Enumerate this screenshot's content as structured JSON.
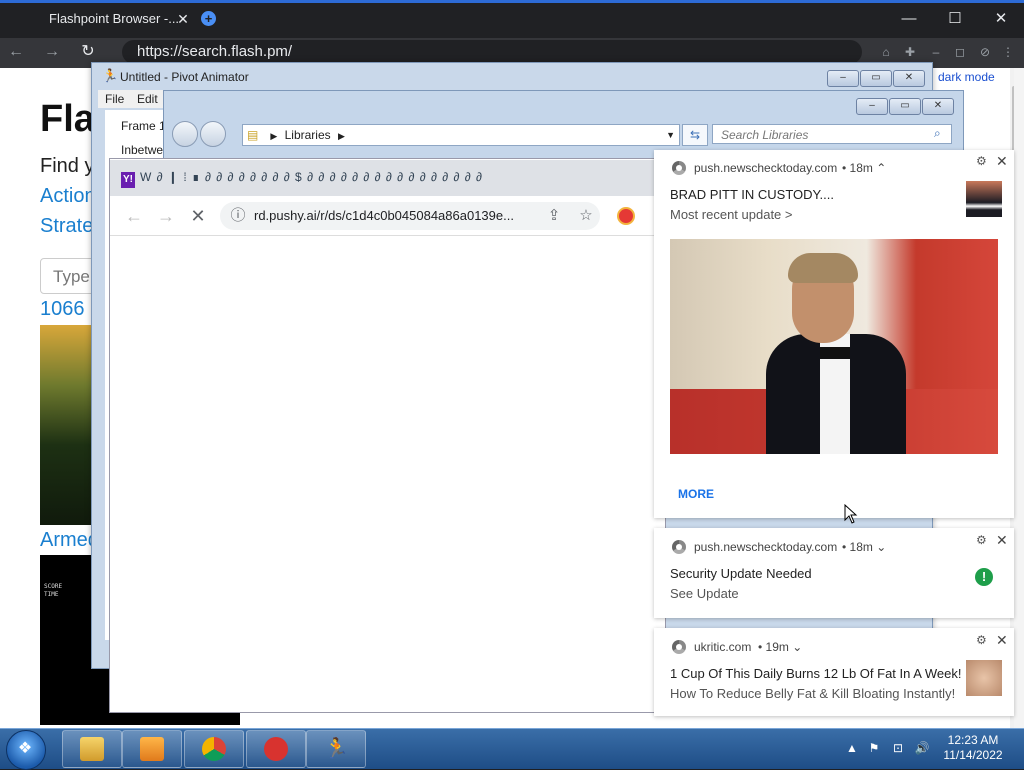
{
  "browser": {
    "tab_title": "Flashpoint Browser -...",
    "url": "https://search.flash.pm/",
    "tab_close": "✕",
    "new_tab": "+",
    "win_min": "—",
    "win_max": "☐",
    "win_close": "✕",
    "back": "←",
    "forward": "→",
    "reload": "↻"
  },
  "page": {
    "title": "Fla",
    "intro": "Find y",
    "link1": "Action",
    "link2": "Strate",
    "search_placeholder": "Type",
    "game1_title": "1066",
    "game2_title": "Armed",
    "dark_mode": "dark mode",
    "game2_score": "SCORE",
    "game2_time": "TIME"
  },
  "pivot": {
    "title": "Untitled - Pivot Animator",
    "menu_file": "File",
    "menu_edit": "Edit",
    "frame_label": "Frame 1",
    "inbetween_label": "Inbetwe",
    "btn_min": "–",
    "btn_max": "▭",
    "btn_close": "✕"
  },
  "explorer": {
    "path": "Libraries",
    "search_placeholder": "Search Libraries",
    "btn_min": "–",
    "btn_max": "▭",
    "btn_close": "✕"
  },
  "chrome_popup": {
    "url": "rd.pushy.ai/r/ds/c1d4c0b045084a86a0139e...",
    "extension_strip": "W ∂  ❙ ⁞ ∎ ∂ ∂ ∂ ∂   ∂ ∂ ∂ ∂ $ ∂ ∂ ∂   ∂ ∂ ∂ ∂ ∂ ∂ ∂ ∂ ∂ ∂ ∂ ∂ ∂"
  },
  "notifications": [
    {
      "source": "push.newschecktoday.com",
      "time": "• 18m ⌃",
      "title": "BRAD PITT IN CUSTODY....",
      "subtitle": "Most recent update >",
      "more": "MORE"
    },
    {
      "source": "push.newschecktoday.com",
      "time": "• 18m ⌄",
      "title": "Security Update Needed",
      "subtitle": "See Update"
    },
    {
      "source": "ukritic.com",
      "time": "• 19m ⌄",
      "title": "1 Cup Of This Daily Burns 12 Lb Of Fat In A Week!",
      "subtitle": "How To Reduce Belly Fat & Kill Bloating Instantly!"
    }
  ],
  "taskbar": {
    "time": "12:23 AM",
    "date": "11/14/2022",
    "tray_up": "▲"
  },
  "colors": {
    "accent": "#2d6bd6",
    "link": "#1a7fcf",
    "notification_more": "#1a73e8",
    "security_badge": "#1e9e4a"
  }
}
